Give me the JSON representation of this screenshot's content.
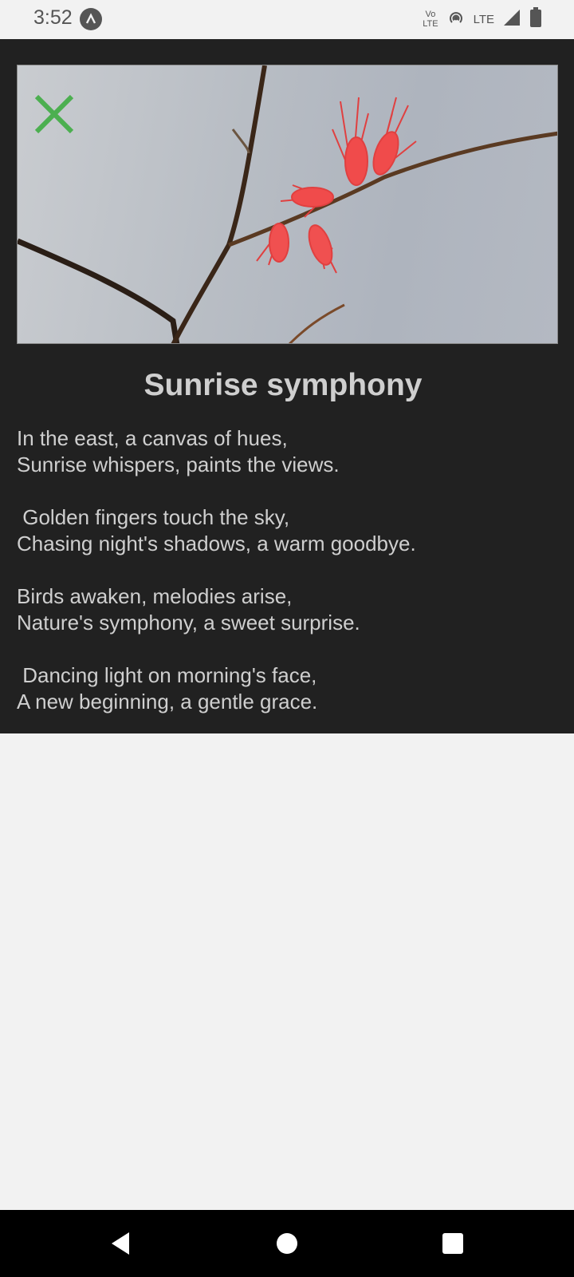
{
  "status_bar": {
    "time": "3:52",
    "volte_top": "Vo",
    "volte_bottom": "LTE",
    "network_label": "LTE"
  },
  "poem": {
    "title": "Sunrise symphony",
    "body": "In the east, a canvas of hues,\nSunrise whispers, paints the views.\n\n Golden fingers touch the sky,\nChasing night's shadows, a warm goodbye.\n\nBirds awaken, melodies arise,\nNature's symphony, a sweet surprise.\n\n Dancing light on morning's face,\nA new beginning, a gentle grace."
  },
  "icons": {
    "close": "close-icon",
    "back": "back-icon",
    "home": "home-icon",
    "recent": "recent-apps-icon"
  },
  "colors": {
    "close_accent": "#4caf50",
    "card_background": "#212121",
    "text": "#cfcfcf",
    "page_background": "#f2f2f2"
  }
}
